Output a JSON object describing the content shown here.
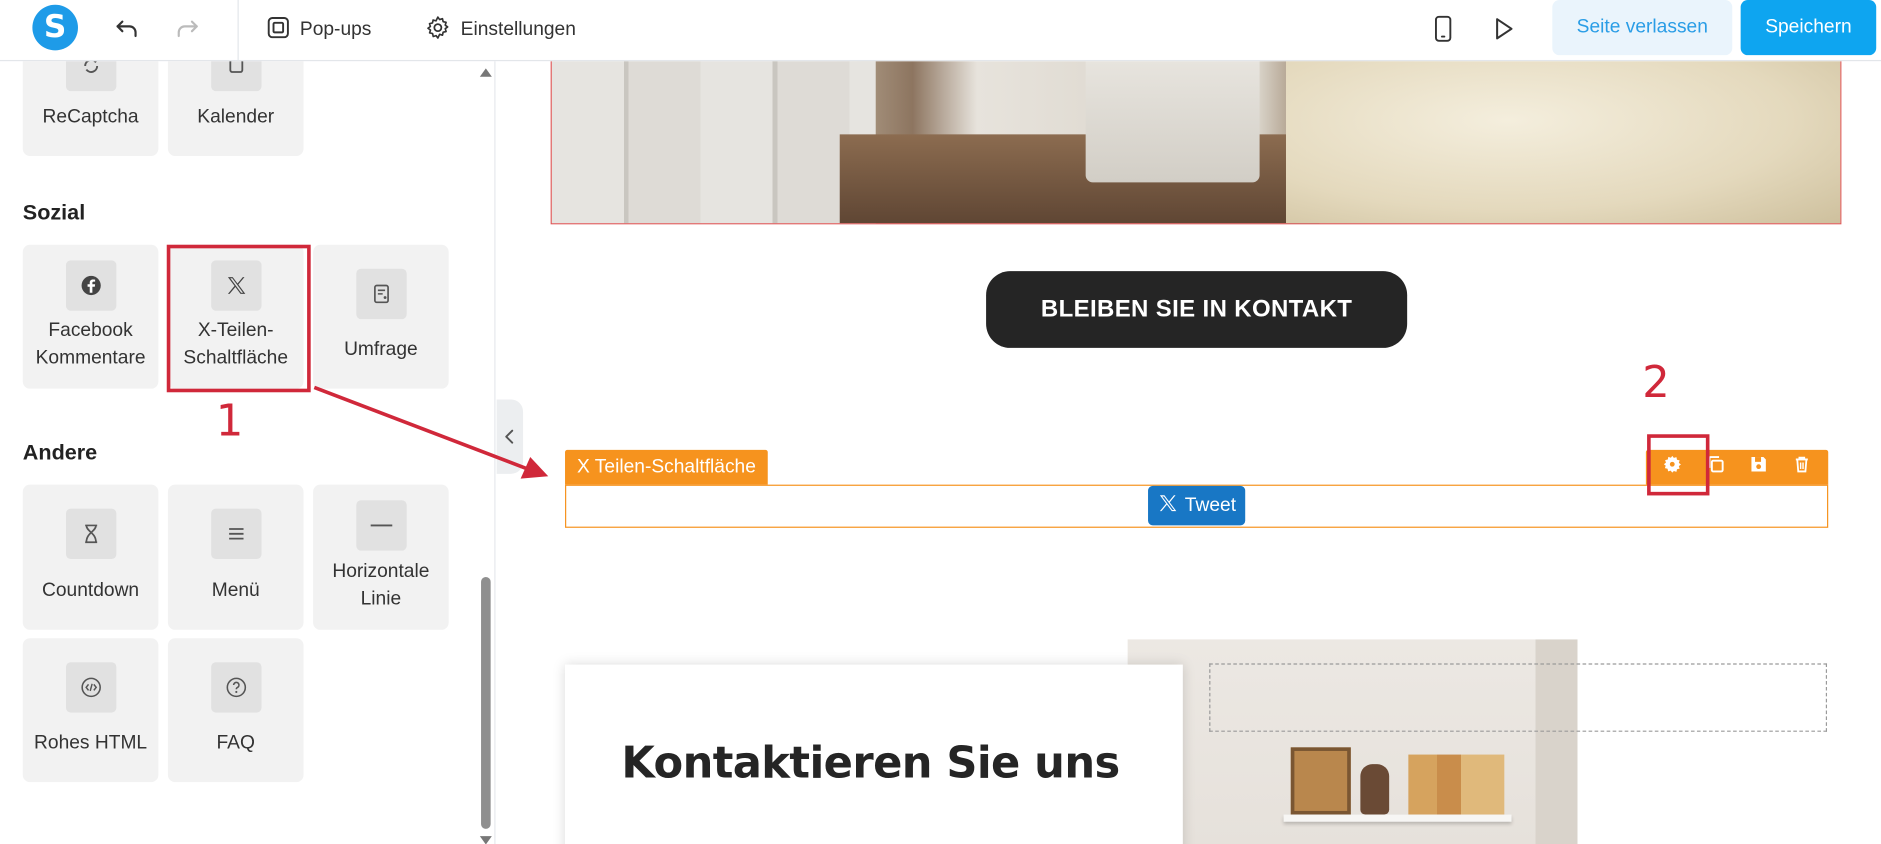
{
  "topbar": {
    "logo_letter": "S",
    "popups_label": "Pop-ups",
    "settings_label": "Einstellungen",
    "leave_label": "Seite verlassen",
    "save_label": "Speichern"
  },
  "sidebar": {
    "top_tiles": [
      {
        "label": "ReCaptcha",
        "icon": "recaptcha-icon"
      },
      {
        "label": "Kalender",
        "icon": "calendar-icon"
      }
    ],
    "sections": [
      {
        "title": "Sozial",
        "tiles": [
          {
            "label": "Facebook Kommentare",
            "icon": "facebook-icon"
          },
          {
            "label": "X-Teilen-Schaltfläche",
            "icon": "x-logo-icon"
          },
          {
            "label": "Umfrage",
            "icon": "poll-icon"
          }
        ]
      },
      {
        "title": "Andere",
        "tiles": [
          {
            "label": "Countdown",
            "icon": "hourglass-icon"
          },
          {
            "label": "Menü",
            "icon": "menu-icon"
          },
          {
            "label": "Horizontale Linie",
            "icon": "horizontal-line-icon"
          },
          {
            "label": "Rohes HTML",
            "icon": "code-icon"
          },
          {
            "label": "FAQ",
            "icon": "question-icon"
          }
        ]
      }
    ]
  },
  "canvas": {
    "cta_label": "BLEIBEN SIE IN KONTAKT",
    "selected_element_label": "X Teilen-Schaltfläche",
    "tweet_label": "Tweet",
    "contact_title": "Kontaktieren Sie uns"
  },
  "annotations": {
    "step1": "1",
    "step2": "2"
  },
  "colors": {
    "brand": "#1e9be8",
    "save": "#0ea5f0",
    "selection": "#f6931e",
    "annotation": "#d0283a",
    "tweet": "#1877c5"
  }
}
